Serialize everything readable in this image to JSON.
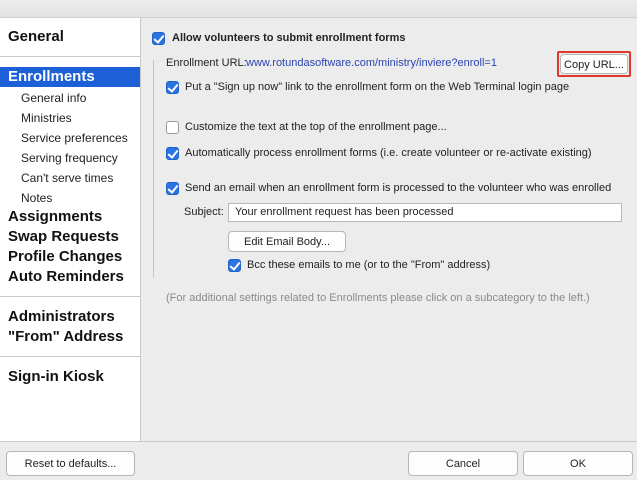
{
  "sidebar": {
    "general": "General",
    "enrollments": "Enrollments",
    "sub_items": [
      "General info",
      "Ministries",
      "Service preferences",
      "Serving frequency",
      "Can't serve times",
      "Notes"
    ],
    "assignments": "Assignments",
    "swap_requests": "Swap Requests",
    "profile_changes": "Profile Changes",
    "auto_reminders": "Auto Reminders",
    "administrators": "Administrators",
    "from_address": "\"From\" Address",
    "signin_kiosk": "Sign-in Kiosk"
  },
  "main": {
    "allow_volunteers": {
      "label": "Allow volunteers to submit enrollment forms",
      "checked": true
    },
    "enrollment_url_label": "Enrollment URL:",
    "enrollment_url": "www.rotundasoftware.com/ministry/inviere?enroll=1",
    "copy_url_button": "Copy URL...",
    "signup_link": {
      "label": "Put a \"Sign up now\" link to the enrollment form on the Web Terminal login page",
      "checked": true
    },
    "customize_text": {
      "label": "Customize the text at the top of the enrollment page...",
      "checked": false
    },
    "auto_process": {
      "label": "Automatically process enrollment forms (i.e. create volunteer or re-activate existing)",
      "checked": true
    },
    "send_email": {
      "label": "Send an email when an enrollment form is processed to the volunteer who was enrolled",
      "checked": true
    },
    "subject_label": "Subject:",
    "subject_value": "Your enrollment request has been processed",
    "edit_email_button": "Edit Email Body...",
    "bcc": {
      "label": "Bcc these emails to me (or to the \"From\" address)",
      "checked": true
    },
    "footer_note": "(For additional settings related to Enrollments please click on a subcategory to the left.)"
  },
  "bottom": {
    "reset_button": "Reset to defaults...",
    "cancel_button": "Cancel",
    "ok_button": "OK"
  },
  "colors": {
    "selection": "#1d5fd6",
    "checkbox": "#2a73e0",
    "link": "#2a44b0",
    "highlight": "#e0392b"
  }
}
